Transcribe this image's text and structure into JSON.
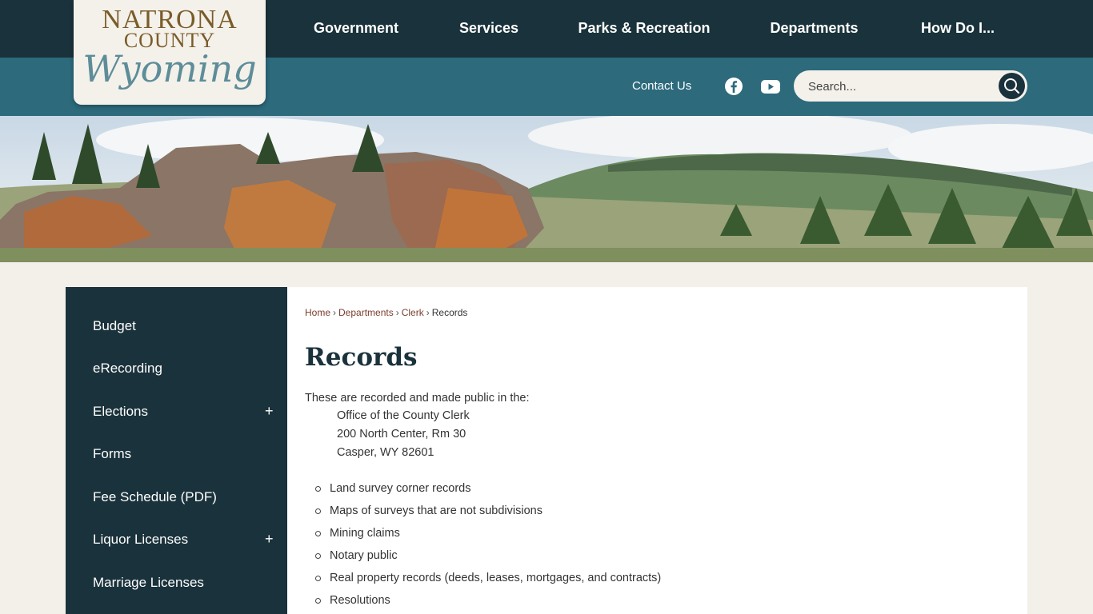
{
  "logo": {
    "line1": "NATRONA",
    "line2": "COUNTY",
    "line3": "Wyoming"
  },
  "nav": [
    {
      "label": "Government"
    },
    {
      "label": "Services"
    },
    {
      "label": "Parks & Recreation"
    },
    {
      "label": "Departments"
    },
    {
      "label": "How Do I..."
    }
  ],
  "utility": {
    "contact_label": "Contact Us",
    "social": [
      "facebook-icon",
      "youtube-icon"
    ],
    "search_placeholder": "Search..."
  },
  "colors": {
    "topbar": "#1a323b",
    "subbar": "#2c6a7c",
    "page_bg": "#f3f0ea",
    "link": "#7a3d2c"
  },
  "sidebar": {
    "items": [
      {
        "label": "Budget",
        "expandable": false
      },
      {
        "label": "eRecording",
        "expandable": false
      },
      {
        "label": "Elections",
        "expandable": true,
        "toggle": "+"
      },
      {
        "label": "Forms",
        "expandable": false
      },
      {
        "label": "Fee Schedule (PDF)",
        "expandable": false
      },
      {
        "label": "Liquor Licenses",
        "expandable": true,
        "toggle": "+"
      },
      {
        "label": "Marriage Licenses",
        "expandable": false
      }
    ]
  },
  "breadcrumb": {
    "home": "Home",
    "departments": "Departments",
    "clerk": "Clerk",
    "current": "Records",
    "sep": "›"
  },
  "page": {
    "title": "Records",
    "intro": "These are recorded and made public in the:",
    "address": [
      "Office of the County Clerk",
      "200 North Center, Rm 30",
      "Casper, WY 82601"
    ],
    "records": [
      "Land survey corner records",
      "Maps of surveys that are not subdivisions",
      "Mining claims",
      "Notary public",
      "Real property records (deeds, leases, mortgages, and contracts)",
      "Resolutions"
    ]
  }
}
